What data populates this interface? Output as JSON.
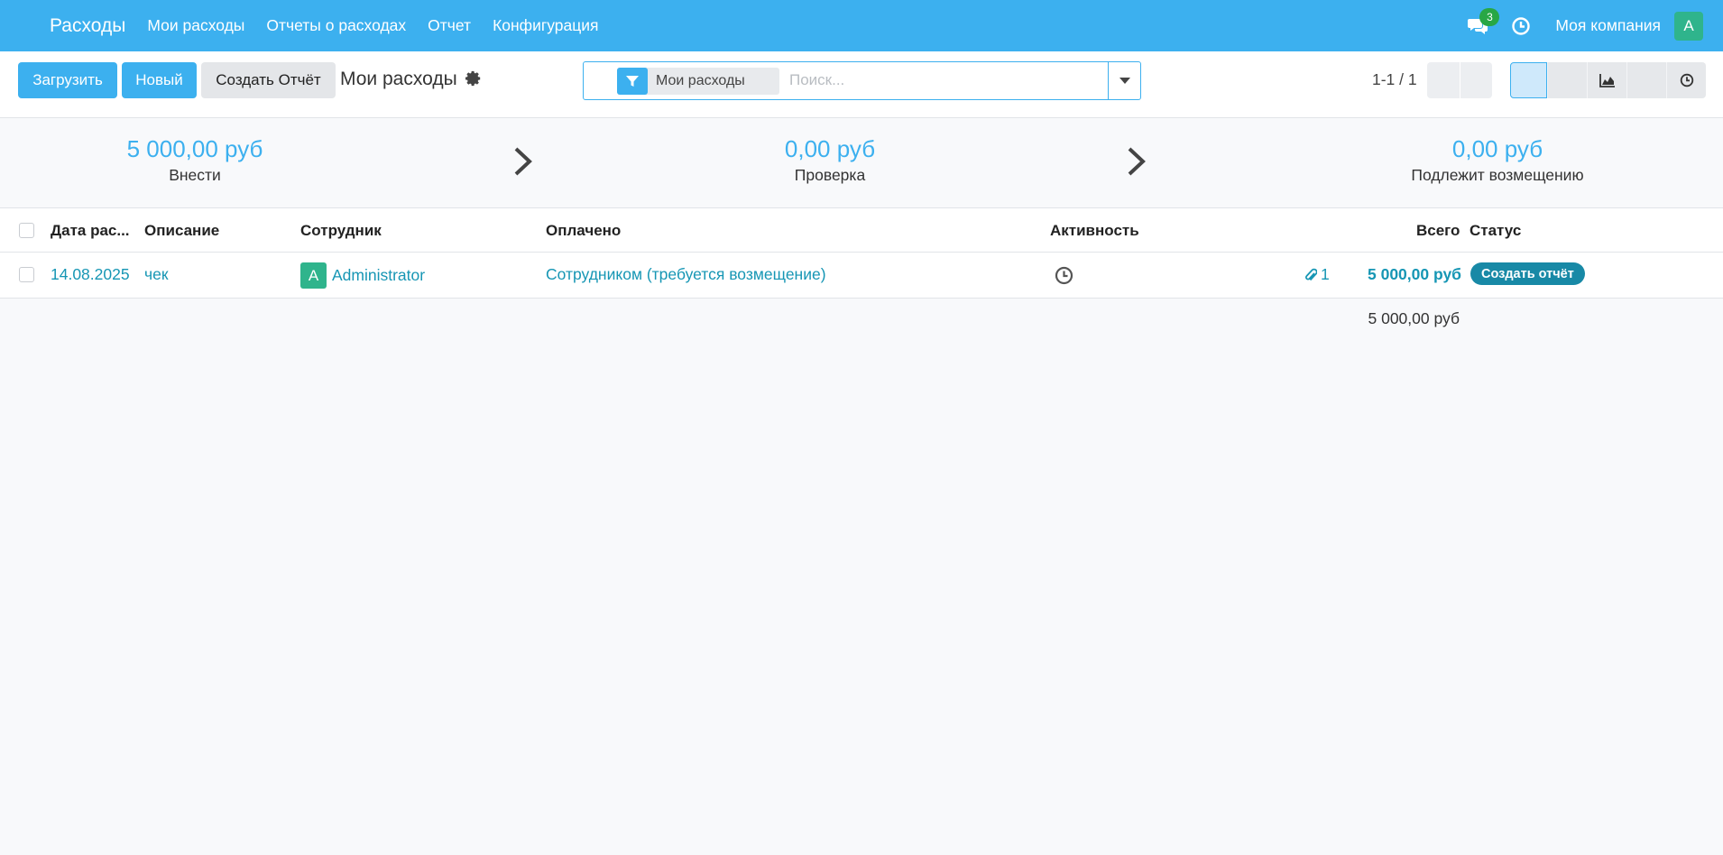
{
  "navbar": {
    "app_title": "Расходы",
    "menu": [
      "Мои расходы",
      "Отчеты о расходах",
      "Отчет",
      "Конфигурация"
    ],
    "messages_count": "3",
    "company": "Моя компания",
    "user_initial": "A",
    "icons": [
      "chat-icon",
      "clock-icon"
    ]
  },
  "control_panel": {
    "upload_label": "Загрузить",
    "new_label": "Новый",
    "create_report_label": "Создать Отчёт",
    "breadcrumb": "Мои расходы",
    "search": {
      "facet_label": "Мои расходы",
      "placeholder": "Поиск..."
    },
    "pager": "1-1 / 1",
    "views": [
      "list-view-icon",
      "kanban-view-icon",
      "graph-view-icon",
      "pivot-view-icon",
      "activity-view-icon"
    ]
  },
  "summary": {
    "stages": [
      {
        "amount": "5 000,00 руб",
        "label": "Внести"
      },
      {
        "amount": "0,00 руб",
        "label": "Проверка"
      },
      {
        "amount": "0,00 руб",
        "label": "Подлежит возмещению"
      }
    ]
  },
  "table": {
    "headers": {
      "date": "Дата рас...",
      "description": "Описание",
      "employee": "Сотрудник",
      "paid_by": "Оплачено",
      "activity": "Активность",
      "total": "Всего",
      "status": "Статус"
    },
    "rows": [
      {
        "date": "14.08.2025",
        "description": "чек",
        "employee_initial": "A",
        "employee": "Administrator",
        "paid_by": "Сотрудником (требуется возмещение)",
        "attachments": "1",
        "total": "5 000,00 руб",
        "status": "Создать отчёт"
      }
    ],
    "footer_total": "5 000,00 руб"
  },
  "colors": {
    "brand": "#3cb0ef",
    "link": "#1696b4",
    "status_badge": "#1889a6",
    "avatar": "#2fb48c",
    "badge": "#28a745"
  }
}
